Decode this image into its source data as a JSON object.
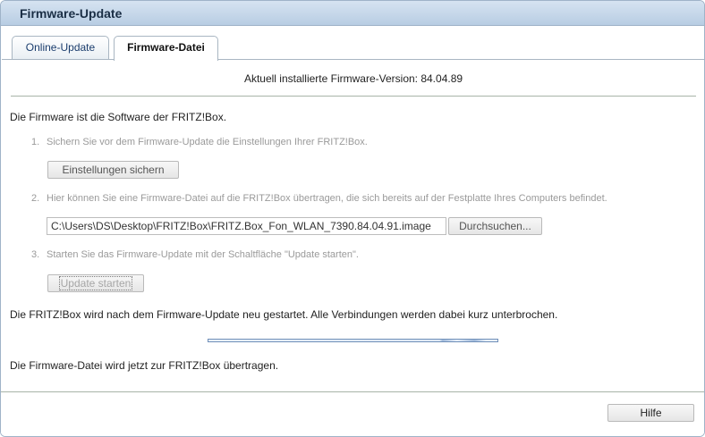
{
  "window": {
    "title": "Firmware-Update"
  },
  "tabs": [
    {
      "label": "Online-Update",
      "active": false
    },
    {
      "label": "Firmware-Datei",
      "active": true
    }
  ],
  "version_line": "Aktuell installierte Firmware-Version: 84.04.89",
  "intro": "Die Firmware ist die Software der FRITZ!Box.",
  "steps": [
    {
      "number": "1.",
      "text": "Sichern Sie vor dem Firmware-Update die Einstellungen Ihrer FRITZ!Box.",
      "button": "Einstellungen sichern"
    },
    {
      "number": "2.",
      "text": "Hier können Sie eine Firmware-Datei auf die FRITZ!Box übertragen, die sich bereits auf der Festplatte Ihres Computers befindet.",
      "file_value": "C:\\Users\\DS\\Desktop\\FRITZ!Box\\FRITZ.Box_Fon_WLAN_7390.84.04.91.image",
      "button": "Durchsuchen..."
    },
    {
      "number": "3.",
      "text": "Starten Sie das Firmware-Update mit der Schaltfläche \"Update starten\".",
      "button": "Update starten"
    }
  ],
  "restart_note": "Die FRITZ!Box wird nach dem Firmware-Update neu gestartet. Alle Verbindungen werden dabei kurz unterbrochen.",
  "status": "Die Firmware-Datei wird jetzt zur FRITZ!Box übertragen.",
  "footer": {
    "help_label": "Hilfe"
  },
  "colors": {
    "titlebar": "#c9d9ea",
    "tab_text": "#1b3d6d",
    "disabled_text": "#9a9a9a",
    "progress_border": "#6f8fb8"
  }
}
